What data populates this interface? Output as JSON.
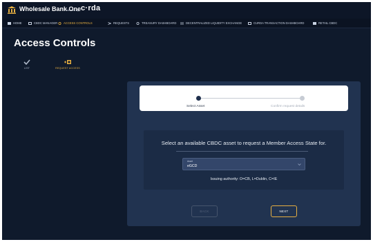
{
  "header": {
    "brand": "Wholesale Bank One",
    "powered_by": "Powered by",
    "crda_logo": "c·rda",
    "logo_icon": "bank-icon"
  },
  "nav": {
    "items": [
      {
        "label": "HOME",
        "icon": "home-icon"
      },
      {
        "label": "CBDC MANAGER",
        "icon": "cbdc-manager-icon"
      },
      {
        "label": "ACCESS CONTROLS",
        "icon": "access-controls-icon",
        "active": true
      },
      {
        "label": "REQUESTS",
        "icon": "requests-icon"
      },
      {
        "label": "TREASURY DASHBOARD",
        "icon": "treasury-icon"
      },
      {
        "label": "DECENTRALIZED LIQUIDITY EXCHANGE",
        "icon": "exchange-icon"
      },
      {
        "label": "CURDA TRANSACTION DASHBOARD",
        "icon": "transaction-dashboard-icon"
      },
      {
        "label": "RETAIL CBDC",
        "icon": "retail-cbdc-icon"
      }
    ],
    "active_color": "#e8b041"
  },
  "page": {
    "title": "Access Controls"
  },
  "tabs": [
    {
      "label": "LIST",
      "icon": "checkmark-icon",
      "active": false
    },
    {
      "label": "REQUEST ACCESS",
      "icon": "request-access-icon",
      "active": true
    }
  ],
  "stepper": {
    "steps": [
      {
        "label": "Select Asset",
        "state": "current"
      },
      {
        "label": "Confirm request details",
        "state": "upcoming"
      }
    ]
  },
  "form": {
    "prompt": "Select an available CBDC asset to request a Member Access State for.",
    "select_label": "Asset",
    "select_value": "eGCD",
    "authority": "Issuing authority: O=CB, L=Dublin, C=IE"
  },
  "buttons": {
    "back": "BACK",
    "next": "NEXT"
  },
  "colors": {
    "background": "#0f1a2c",
    "panel": "#213350",
    "accent": "#e8b041"
  }
}
